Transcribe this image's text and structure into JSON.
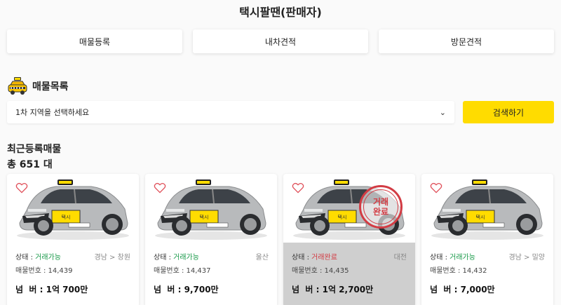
{
  "header": {
    "title": "택시팔땐(판매자)"
  },
  "top_buttons": [
    {
      "label": "매물등록"
    },
    {
      "label": "내차견적"
    },
    {
      "label": "방문견적"
    }
  ],
  "listing": {
    "heading": "매물목록",
    "region_select": {
      "value": "1차 지역을 선택하세요"
    },
    "search_label": "검색하기",
    "recent_label": "최근등록매물",
    "total_label": "총 651 대"
  },
  "cards": [
    {
      "status_label": "상태 : ",
      "status": "거래가능",
      "region": "경남 > 창원",
      "number": "매물번호 : 14,439",
      "price": "넘  버 : 1억 700만",
      "completed": false
    },
    {
      "status_label": "상태 : ",
      "status": "거래가능",
      "region": "울산",
      "number": "매물번호 : 14,437",
      "price": "넘  버 : 9,700만",
      "completed": false
    },
    {
      "status_label": "상태 : ",
      "status": "거래완료",
      "region": "대전",
      "number": "매물번호 : 14,435",
      "price": "넘  버 : 1억 2,700만",
      "completed": true,
      "stamp": "거래\n완료"
    },
    {
      "status_label": "상태 : ",
      "status": "거래가능",
      "region": "경남 > 밀양",
      "number": "매물번호 : 14,432",
      "price": "넘  버 : 7,000만",
      "completed": false
    }
  ],
  "colors": {
    "accent": "#ffdc00",
    "available": "#1a9a4a",
    "completed": "#d23c44"
  }
}
